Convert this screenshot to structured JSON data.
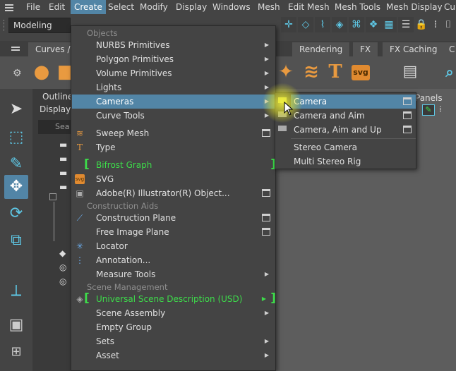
{
  "menubar": {
    "items": [
      "File",
      "Edit",
      "Create",
      "Select",
      "Modify",
      "Display",
      "Windows",
      "Mesh",
      "Edit Mesh",
      "Mesh Tools",
      "Mesh Display",
      "Cur"
    ],
    "active": "Create"
  },
  "toolbar_row": {
    "mode": "Modeling"
  },
  "shelf": {
    "tabs": [
      "Curves / S",
      "Rendering",
      "FX",
      "FX Caching",
      "C"
    ],
    "svg_label": "svg",
    "text_label": "T"
  },
  "outliner": {
    "title": "Outliner",
    "display": "Display",
    "search": "Sea"
  },
  "viewport": {
    "panels": "Panels"
  },
  "create_menu": {
    "sections": {
      "objects": "Objects",
      "construction_aids": "Construction Aids",
      "scene_management": "Scene Management"
    },
    "items": {
      "nurbs": "NURBS Primitives",
      "polygon": "Polygon Primitives",
      "volume": "Volume Primitives",
      "lights": "Lights",
      "cameras": "Cameras",
      "curve_tools": "Curve Tools",
      "sweep_mesh": "Sweep Mesh",
      "type": "Type",
      "bifrost_graph": "Bifrost Graph",
      "svg": "SVG",
      "illustrator": "Adobe(R) Illustrator(R) Object...",
      "construction_plane": "Construction Plane",
      "free_image_plane": "Free Image Plane",
      "locator": "Locator",
      "annotation": "Annotation...",
      "measure_tools": "Measure Tools",
      "usd": "Universal Scene Description (USD)",
      "scene_assembly": "Scene Assembly",
      "empty_group": "Empty Group",
      "sets": "Sets",
      "asset": "Asset"
    }
  },
  "cameras_submenu": {
    "camera": "Camera",
    "camera_aim": "Camera and Aim",
    "camera_aim_up": "Camera, Aim and Up",
    "stereo": "Stereo Camera",
    "multi_stereo": "Multi Stereo Rig"
  },
  "colors": {
    "highlight": "#5285a6",
    "panel": "#444444",
    "green_text": "#3ddc4a",
    "accent_orange": "#e99a40",
    "icon_blue": "#5ec8e6"
  }
}
